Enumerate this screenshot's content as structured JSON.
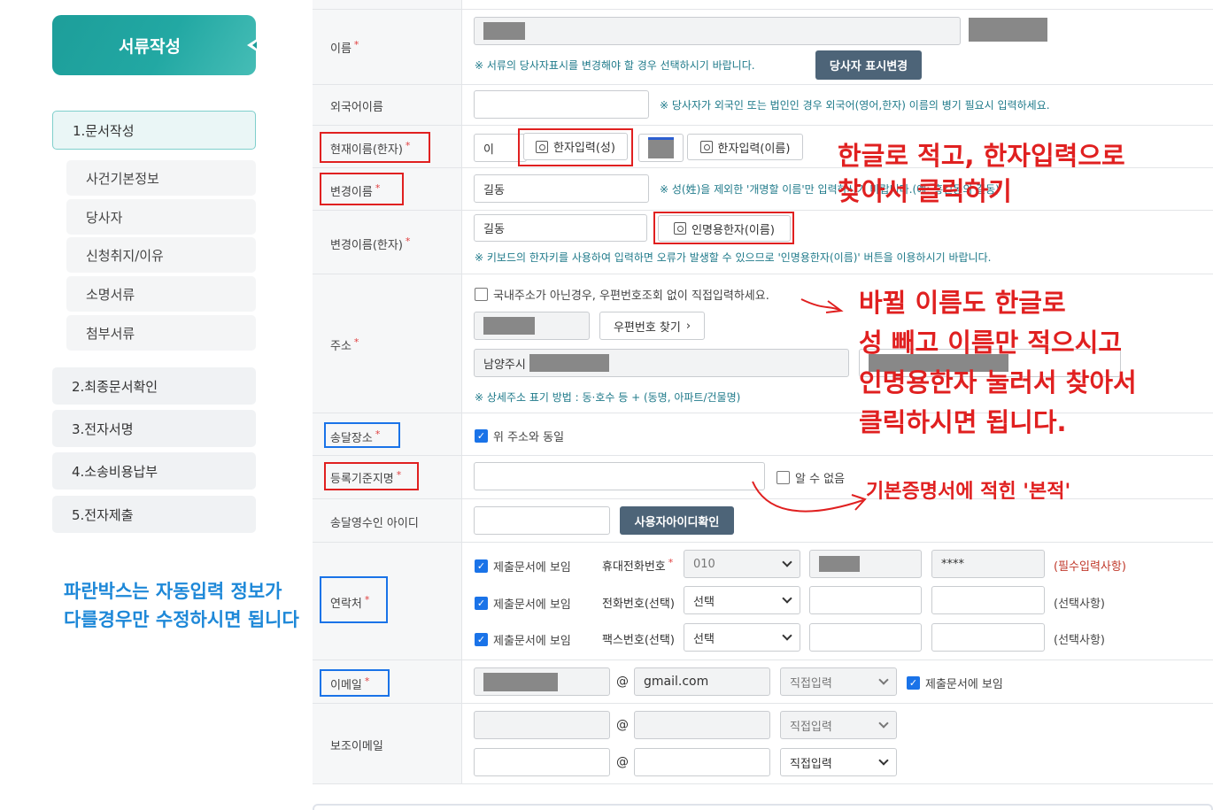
{
  "sidebar": {
    "header": "서류작성",
    "step1": "1.문서작성",
    "sub": [
      "사건기본정보",
      "당사자",
      "신청취지/이유",
      "소명서류",
      "첨부서류"
    ],
    "step2": "2.최종문서확인",
    "step3": "3.전자서명",
    "step4": "4.소송비용납부",
    "step5": "5.전자제출",
    "note": "파란박스는 자동입력 정보가 다를경우만 수정하시면 됩니다"
  },
  "form": {
    "req_mark": "*",
    "name": {
      "label": "이름",
      "note": "※ 서류의 당사자표시를 변경해야 할 경우 선택하시기 바랍니다.",
      "button": "당사자 표시변경"
    },
    "foreign": {
      "label": "외국어이름",
      "note": "※ 당사자가 외국인 또는 법인인 경우 외국어(영어,한자) 이름의 병기 필요시 입력하세요."
    },
    "cur_hanja": {
      "label": "현재이름(한자)",
      "surname": "이",
      "btn_surname": "한자입력(성)",
      "btn_given": "한자입력(이름)"
    },
    "changed": {
      "label": "변경이름",
      "value": "길동",
      "note": "※ 성(姓)을 제외한 '개명할 이름'만 입력하시기 바랍니다.(예: 홍길동의 길동)"
    },
    "changed_hanja": {
      "label": "변경이름(한자)",
      "value": "길동",
      "button": "인명용한자(이름)",
      "note": "※ 키보드의 한자키를 사용하여 입력하면 오류가 발생할 수 있으므로 '인명용한자(이름)' 버튼을 이용하시기 바랍니다."
    },
    "address": {
      "label": "주소",
      "checkbox": "국내주소가 아닌경우, 우편번호조회 없이 직접입력하세요.",
      "zip_button": "우편번호 찾기",
      "addr1": "남양주시",
      "note": "※ 상세주소 표기 방법 : 동·호수 등 + (동명, 아파트/건물명)"
    },
    "delivery": {
      "label": "송달장소",
      "checkbox": "위 주소와 동일"
    },
    "regplace": {
      "label": "등록기준지명",
      "checkbox": "알 수 없음"
    },
    "receiver": {
      "label": "송달영수인 아이디",
      "button": "사용자아이디확인"
    },
    "contact": {
      "label": "연락처",
      "rows": [
        {
          "check": "제출문서에 보임",
          "type": "휴대전화번호",
          "select": "010",
          "mid": "",
          "last": "****",
          "tag": "(필수입력사항)"
        },
        {
          "check": "제출문서에 보임",
          "type": "전화번호(선택)",
          "select": "선택",
          "mid": "",
          "last": "",
          "tag": "(선택사항)"
        },
        {
          "check": "제출문서에 보임",
          "type": "팩스번호(선택)",
          "select": "선택",
          "mid": "",
          "last": "",
          "tag": "(선택사항)"
        }
      ]
    },
    "email": {
      "label": "이메일",
      "at": "@",
      "domain": "gmail.com",
      "select": "직접입력",
      "check": "제출문서에 보임"
    },
    "email2": {
      "label": "보조이메일",
      "at": "@",
      "select1": "직접입력",
      "select2": "직접입력"
    }
  },
  "annotations": {
    "a1_line1": "한글로 적고, 한자입력으로",
    "a1_line2": "찾아서 클릭하기",
    "a2": [
      "바뀔 이름도 한글로",
      "성 빼고 이름만 적으시고",
      "인명용한자 눌러서 찾아서",
      "클릭하시면 됩니다."
    ],
    "a3": "기본증명서에 적힌 '본적'"
  },
  "colors": {
    "teal": "#1d9e9a",
    "annotation_red": "#e02020",
    "annotation_blue": "#1a73e8",
    "dark_button": "#4d6478"
  }
}
